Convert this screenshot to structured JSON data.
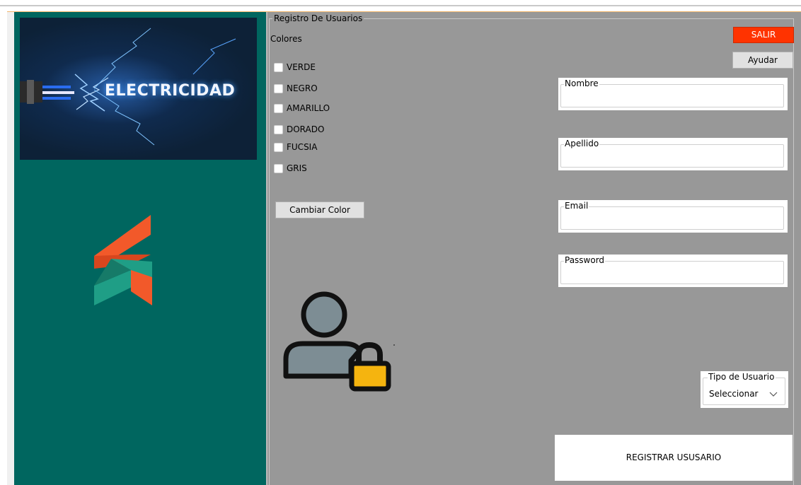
{
  "banner": {
    "text": "ELECTRICIDAD"
  },
  "group": {
    "title": "Registro De Usuarios"
  },
  "colors_section": {
    "label": "Colores",
    "options": [
      "VERDE",
      "NEGRO",
      "AMARILLO",
      "DORADO",
      "FUCSIA",
      "GRIS"
    ],
    "button_label": "Cambiar Color"
  },
  "buttons": {
    "exit_label": "SALIR",
    "help_label": "Ayudar",
    "register_label": "REGISTRAR USUSARIO"
  },
  "fields": {
    "nombre_label": "Nombre",
    "apellido_label": "Apellido",
    "email_label": "Email",
    "password_label": "Password",
    "nombre_value": "",
    "apellido_value": "",
    "email_value": "",
    "password_value": ""
  },
  "user_type": {
    "label": "Tipo de Usuario",
    "selected": "Seleccionar"
  },
  "icons": {
    "logo": "brand-logo-icon",
    "user_lock": "user-lock-icon",
    "chevron": "chevron-down-icon"
  },
  "colors": {
    "left_panel": "#00665f",
    "main_area": "#989898",
    "exit_button": "#ff3300",
    "lock": "#f5b40f",
    "user_figure": "#7d8d94",
    "logo_orange": "#f2592a",
    "logo_teal": "#1f9e86"
  }
}
